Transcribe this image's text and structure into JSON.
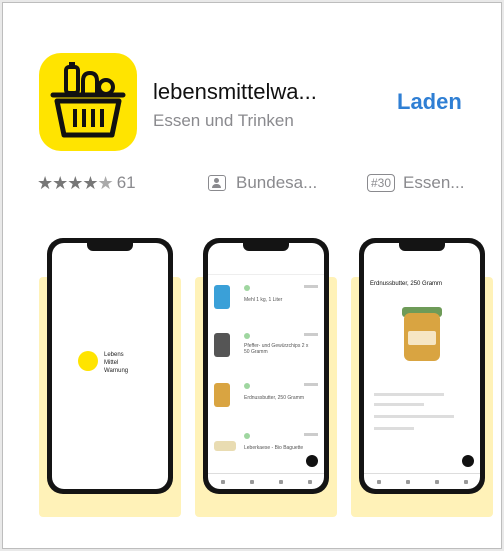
{
  "app": {
    "name": "lebensmittelwa...",
    "category": "Essen und Trinken",
    "get_label": "Laden",
    "icon": "shopping-basket-icon",
    "icon_color": "#ffe400"
  },
  "meta": {
    "rating_count": "61",
    "rating_stars": 4.5,
    "developer": "Bundesa...",
    "rank_badge": "#30",
    "rank_category": "Essen..."
  },
  "screenshots": [
    {
      "logo_lines": [
        "Lebens",
        "Mittel",
        "Warnung"
      ]
    },
    {
      "items": [
        "Mehl 1 kg, 1 Liter",
        "Pfeffer- und Gewürzchips 2 x 50 Gramm",
        "Erdnussbutter, 250 Gramm",
        "Leberkaese - Bio Baguette"
      ]
    },
    {
      "title": "Erdnussbutter, 250 Gramm"
    }
  ],
  "colors": {
    "accent": "#2f7fd4",
    "screenshot_bg": "#fff2b8"
  }
}
